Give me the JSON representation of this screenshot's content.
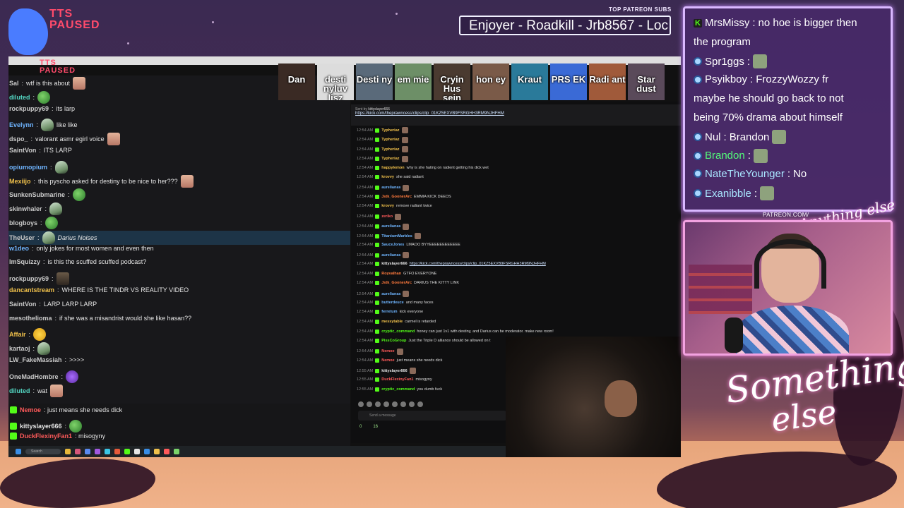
{
  "overlay": {
    "tts_status": "TTS\nPAUSED",
    "tts_status_small": "TTS\nPAUSED",
    "top_patreon_label": "TOP PATREON SUBS",
    "ticker_text": "Enjoyer - Roadkill - Jrb8567 - Loc",
    "patreon_url": "PATREON.COM/",
    "anything_else_logo": "Anything else",
    "something_else_logo_line1": "Something",
    "something_else_logo_line2": "else"
  },
  "emote_bar": [
    {
      "label": "Dan"
    },
    {
      "label": "desti nyluv lisz"
    },
    {
      "label": "Desti ny"
    },
    {
      "label": "em mie"
    },
    {
      "label": "Cryin Hus sein"
    },
    {
      "label": "hon ey"
    },
    {
      "label": "Kraut"
    },
    {
      "label": "PRS EK"
    },
    {
      "label": "Radi ant"
    },
    {
      "label": "Star dust"
    }
  ],
  "left_chat": [
    {
      "user": "Sal",
      "color": "#c9c9c9",
      "text": "wtf is this about",
      "emote": "face",
      "emote_pos": "after"
    },
    {
      "user": "diluted",
      "color": "#53d6c2",
      "text": "",
      "emote": "frog",
      "emote_pos": "after"
    },
    {
      "user": "rockpuppy69",
      "color": "#c9c9c9",
      "text": "its larp",
      "emote": "",
      "emote_pos": ""
    },
    {
      "user": "Evelynn",
      "color": "#6fb5ff",
      "text": "like like",
      "emote": "wiz",
      "emote_pos": "before"
    },
    {
      "user": "dspo_",
      "color": "#c9c9c9",
      "text": "valorant asmr egirl voice",
      "emote": "face",
      "emote_pos": "after"
    },
    {
      "user": "SaintVon",
      "color": "#c9c9c9",
      "text": "ITS LARP",
      "emote": "",
      "emote_pos": ""
    },
    {
      "user": "opiumopium",
      "color": "#6fb5ff",
      "text": "",
      "emote": "wiz",
      "emote_pos": "after"
    },
    {
      "user": "Mexiijo",
      "color": "#f0c04b",
      "text": "this pyscho asked for destiny to be nice to her???",
      "emote": "face",
      "emote_pos": "after"
    },
    {
      "user": "SunkenSubmarine",
      "color": "#c9c9c9",
      "text": "",
      "emote": "frog",
      "emote_pos": "after"
    },
    {
      "user": "skinwhaler",
      "color": "#c9c9c9",
      "text": "",
      "emote": "wiz",
      "emote_pos": "after"
    },
    {
      "user": "blogboys",
      "color": "#c9c9c9",
      "text": "",
      "emote": "frog",
      "emote_pos": "after"
    },
    {
      "user": "TheUser",
      "color": "#c9c9c9",
      "text": "Darius Noises",
      "emote": "wiz",
      "emote_pos": "before"
    },
    {
      "user": "w1deo",
      "color": "#6fb5ff",
      "text": "only jokes for most women and even then",
      "emote": "",
      "emote_pos": ""
    },
    {
      "user": "ImSquizzy",
      "color": "#c9c9c9",
      "text": "is this the scuffed scuffed podcast?",
      "emote": "",
      "emote_pos": ""
    },
    {
      "user": "rockpuppy69",
      "color": "#c9c9c9",
      "text": "",
      "emote": "dark",
      "emote_pos": "after"
    },
    {
      "user": "dancantstream",
      "color": "#f0c04b",
      "text": "WHERE IS THE TINDR VS REALITY VIDEO",
      "emote": "",
      "emote_pos": ""
    },
    {
      "user": "SaintVon",
      "color": "#c9c9c9",
      "text": "LARP LARP LARP",
      "emote": "",
      "emote_pos": ""
    },
    {
      "user": "mesothelioma",
      "color": "#c9c9c9",
      "text": "if she was a misandrist would she like hasan??",
      "emote": "",
      "emote_pos": ""
    },
    {
      "user": "Affair",
      "color": "#f0c04b",
      "text": "",
      "emote": "sweat",
      "emote_pos": "after"
    },
    {
      "user": "kartaoj",
      "color": "#c9c9c9",
      "text": "",
      "emote": "wiz",
      "emote_pos": "after"
    },
    {
      "user": "LW_FakeMassiah",
      "color": "#c9c9c9",
      "text": ">>>>",
      "emote": "",
      "emote_pos": ""
    },
    {
      "user": "OneMadHombre",
      "color": "#c9c9c9",
      "text": "",
      "emote": "grape",
      "emote_pos": "after"
    },
    {
      "user": "diluted",
      "color": "#53d6c2",
      "text": "wat",
      "emote": "face",
      "emote_pos": "after"
    }
  ],
  "left_chat_sep": ":",
  "left_bottom": [
    {
      "user": "Nemoe",
      "color": "#ff5a5a",
      "text": ": just means she needs dick",
      "emote": ""
    },
    {
      "user": "kittyslayer666",
      "color": "#e6e6e6",
      "text": ":",
      "emote": "frog"
    },
    {
      "user": "DuckFlexinyFan1",
      "color": "#ff5a5a",
      "text": ": misogyny",
      "emote": ""
    },
    {
      "user": "cryptic_command",
      "color": "#53fc18",
      "text": ": you dumb fuck",
      "emote": "dark"
    }
  ],
  "kick_chat": {
    "pinned_label": "Sent by",
    "pinned_user": "kittyslayer666",
    "pinned_link": "https://kick.com/theprawncess/clips/clip_01KZ5EXVB9FSRGHH3RM9NJHFHM",
    "input_placeholder": "Send a message",
    "stat_a": "0",
    "stat_b": "16",
    "lines": [
      {
        "time": "12:54 AM",
        "user": "Typheriaz",
        "color": "#f0c04b",
        "text": "",
        "em": true
      },
      {
        "time": "12:54 AM",
        "user": "Typheriaz",
        "color": "#f0c04b",
        "text": "",
        "em": true
      },
      {
        "time": "12:54 AM",
        "user": "Typheriaz",
        "color": "#f0c04b",
        "text": "",
        "em": true
      },
      {
        "time": "12:54 AM",
        "user": "Typheriaz",
        "color": "#f0c04b",
        "text": "",
        "em": true
      },
      {
        "time": "12:54 AM",
        "user": "happylemon",
        "color": "#f0c04b",
        "text": "why is she hating on radient getting his dick wet",
        "em": false
      },
      {
        "time": "12:54 AM",
        "user": "krovvy",
        "color": "#f0c04b",
        "text": "she said radiant",
        "em": false
      },
      {
        "time": "12:54 AM",
        "user": "aurelianas",
        "color": "#6fb5ff",
        "text": "",
        "em": true
      },
      {
        "time": "12:54 AM",
        "user": "Jstk_GoonerArc",
        "color": "#ff7a3d",
        "text": "EMMIA KICK DEEDS",
        "em": false
      },
      {
        "time": "12:54 AM",
        "user": "krovvy",
        "color": "#f0c04b",
        "text": "remove radiant twice",
        "em": false
      },
      {
        "time": "12:54 AM",
        "user": "zeriko",
        "color": "#ff5a5a",
        "text": "",
        "em": true
      },
      {
        "time": "12:54 AM",
        "user": "aurelianas",
        "color": "#6fb5ff",
        "text": "",
        "em": true
      },
      {
        "time": "12:54 AM",
        "user": "TitaniumMarbles",
        "color": "#6fb5ff",
        "text": "",
        "em": true
      },
      {
        "time": "12:54 AM",
        "user": "SauceJones",
        "color": "#6fb5ff",
        "text": "LMAOO BYYEEEEEEEEEEEE",
        "em": false
      },
      {
        "time": "12:54 AM",
        "user": "aurelianas",
        "color": "#6fb5ff",
        "text": "",
        "em": true
      },
      {
        "time": "12:54 AM",
        "user": "kittyslayer666",
        "color": "#e6e6e6",
        "text": "https://kick.com/theprawncess/clips/clip_01KZ5EXVB9FSRGHH3RM9NJHFHM",
        "em": false
      },
      {
        "time": "12:54 AM",
        "user": "Royvalhan",
        "color": "#ff7a3d",
        "text": "GTFO EVERYONE",
        "em": false
      },
      {
        "time": "12:54 AM",
        "user": "Jstk_GoonerArc",
        "color": "#ff7a3d",
        "text": "DARIUS THE KITTY LINK",
        "em": false
      },
      {
        "time": "12:54 AM",
        "user": "aurelianas",
        "color": "#6fb5ff",
        "text": "",
        "em": true
      },
      {
        "time": "12:54 AM",
        "user": "butterdeuce",
        "color": "#6fb5ff",
        "text": "and many faces",
        "em": false
      },
      {
        "time": "12:54 AM",
        "user": "ferretum",
        "color": "#6fb5ff",
        "text": "kick everyone",
        "em": false
      },
      {
        "time": "12:54 AM",
        "user": "messytable",
        "color": "#f0c04b",
        "text": "carmel is retarded",
        "em": false
      },
      {
        "time": "12:54 AM",
        "user": "cryptic_command",
        "color": "#53fc18",
        "text": "honey can just 1v1 with destiny, and Darius can be moderator. make new room!",
        "em": false
      },
      {
        "time": "12:54 AM",
        "user": "PissCoGroup",
        "color": "#53fc18",
        "text": "Just the Triple D alliance should be allowed on t",
        "em": false
      },
      {
        "time": "12:54 AM",
        "user": "Nemoe",
        "color": "#ff5a5a",
        "text": "",
        "em": true
      },
      {
        "time": "12:54 AM",
        "user": "Nemoe",
        "color": "#ff5a5a",
        "text": "just means she needs dick",
        "em": false
      },
      {
        "time": "12:55 AM",
        "user": "kittyslayer666",
        "color": "#e6e6e6",
        "text": "",
        "em": true
      },
      {
        "time": "12:55 AM",
        "user": "DuckFlexinyFan1",
        "color": "#ff5a5a",
        "text": "misogyny",
        "em": false
      },
      {
        "time": "12:55 AM",
        "user": "cryptic_command",
        "color": "#53fc18",
        "text": "you dumb fuck",
        "em": false
      }
    ]
  },
  "taskbar": {
    "search_placeholder": "Search"
  },
  "overlay_chat": [
    {
      "user": "MrsMissy",
      "color": "#ffffff",
      "badge": "kick",
      "text": "no hoe is bigger then",
      "emote": false
    },
    {
      "user": "",
      "color": "#ffffff",
      "badge": "",
      "text": "the program",
      "emote": false
    },
    {
      "user": "Spr1ggs",
      "color": "#ffffff",
      "badge": "twitch",
      "text": "",
      "emote": true
    },
    {
      "user": "Psyikboy",
      "color": "#ffffff",
      "badge": "twitch",
      "text": "FrozzyWozzy fr",
      "emote": false
    },
    {
      "user": "",
      "color": "#ffffff",
      "badge": "",
      "text": "maybe he should go back to not",
      "emote": false
    },
    {
      "user": "",
      "color": "#ffffff",
      "badge": "",
      "text": "being 70% drama about himself",
      "emote": false
    },
    {
      "user": "Nul",
      "color": "#ffffff",
      "badge": "twitch",
      "text": "Brandon",
      "emote": true
    },
    {
      "user": "Brandon",
      "color": "#53fc7a",
      "badge": "twitch",
      "text": "",
      "emote": true
    },
    {
      "user": "NateTheYounger",
      "color": "#a9e6ff",
      "badge": "twitch",
      "text": "No",
      "emote": false
    },
    {
      "user": "Exanibble",
      "color": "#a9e6ff",
      "badge": "twitch",
      "text": "",
      "emote": true
    }
  ],
  "colors": {
    "accent_purple": "#d9b8ff",
    "accent_pink": "#f2a2e0",
    "kick_green": "#53fc18"
  }
}
